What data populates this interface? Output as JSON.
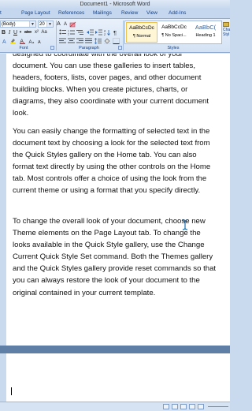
{
  "window": {
    "title": "Document1 - Microsoft Word"
  },
  "tabs": [
    "t",
    "Page Layout",
    "References",
    "Mailings",
    "Review",
    "View",
    "Add-Ins"
  ],
  "ribbon": {
    "font_name": "(Body)",
    "font_size": "20",
    "buttons": {
      "bold": "B",
      "italic": "I",
      "underline": "U",
      "subscript": "abe",
      "superscript": "x²",
      "change_case": "Aa",
      "grow_font": "A",
      "shrink_font": "A"
    },
    "groups": {
      "font": "Font",
      "paragraph": "Paragraph",
      "styles": "Styles"
    },
    "styles": [
      {
        "preview": "AaBbCcDc",
        "name": "¶ Normal",
        "selected": true
      },
      {
        "preview": "AaBbCcDc",
        "name": "¶ No Spaci...",
        "selected": false
      },
      {
        "preview": "AaBbC(",
        "name": "Heading 1",
        "selected": false
      }
    ],
    "change_styles": "Cha Styl"
  },
  "document": {
    "page1_paragraphs": [
      "designed to coordinate with the overall look of your document. You can use these galleries to insert tables, headers, footers, lists, cover pages, and other document building blocks. When you create pictures, charts, or diagrams, they also coordinate with your current document look.",
      "You can easily change the formatting of selected text in the document text by choosing a look for the selected text from the Quick Styles gallery on the Home tab. You can also format text directly by using the other controls on the Home tab. Most controls offer a choice of using the look from the current theme or using a format that you specify directly.",
      "To change the overall look of your document, choose new Theme elements on the Page Layout tab. To change the looks available in the Quick Style gallery, use the Change Current Quick Style Set command. Both the Themes gallery and the Quick Styles gallery provide reset commands so that you can always restore the look of your document to the original contained in your current template."
    ]
  },
  "colors": {
    "accent": "#15428b",
    "ribbon_bg": "#d3e2f4",
    "page_gap": "#5f7fa6"
  }
}
